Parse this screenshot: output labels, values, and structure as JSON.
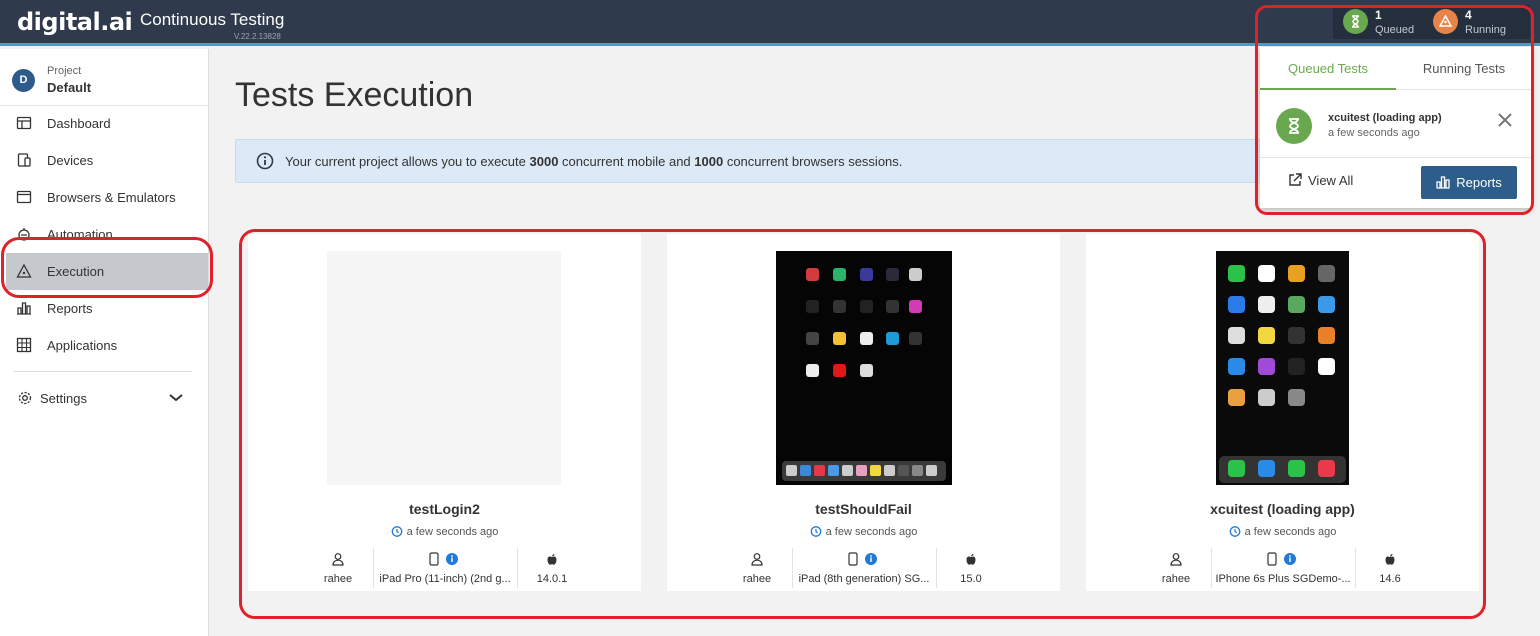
{
  "header": {
    "logo": "digital.ai",
    "app_title": "Continuous Testing",
    "version": "V.22.2.13828",
    "queued": {
      "count": "1",
      "label": "Queued",
      "icon": "hourglass-icon",
      "color": "#6aa84f"
    },
    "running": {
      "count": "4",
      "label": "Running",
      "icon": "running-icon",
      "color": "#e8834a"
    }
  },
  "sidebar": {
    "project_initial": "D",
    "project_label": "Project",
    "project_name": "Default",
    "items": [
      {
        "label": "Dashboard",
        "icon": "dashboard-icon"
      },
      {
        "label": "Devices",
        "icon": "devices-icon"
      },
      {
        "label": "Browsers & Emulators",
        "icon": "browser-icon"
      },
      {
        "label": "Automation",
        "icon": "automation-icon"
      },
      {
        "label": "Execution",
        "icon": "execution-icon",
        "active": true
      },
      {
        "label": "Reports",
        "icon": "reports-icon"
      },
      {
        "label": "Applications",
        "icon": "applications-icon"
      }
    ],
    "settings_label": "Settings"
  },
  "main": {
    "title": "Tests Execution",
    "banner": {
      "prefix": "Your current project allows you to execute ",
      "mobile_count": "3000",
      "middle": " concurrent mobile and ",
      "browser_count": "1000",
      "suffix": " concurrent browsers sessions."
    },
    "cards": [
      {
        "name": "testLogin2",
        "time": "a few seconds ago",
        "user": "rahee",
        "device": "iPad Pro (11-inch) (2nd g...",
        "os": "14.0.1"
      },
      {
        "name": "testShouldFail",
        "time": "a few seconds ago",
        "user": "rahee",
        "device": "iPad (8th generation) SG...",
        "os": "15.0"
      },
      {
        "name": "xcuitest (loading app)",
        "time": "a few seconds ago",
        "user": "rahee",
        "device": "IPhone 6s Plus SGDemo-...",
        "os": "14.6"
      }
    ]
  },
  "popup": {
    "tabs": [
      "Queued Tests",
      "Running Tests"
    ],
    "item": {
      "name": "xcuitest (loading app)",
      "time": "a few seconds ago"
    },
    "view_all": "View All",
    "reports": "Reports"
  },
  "colors": {
    "accent_green": "#6aa84f",
    "accent_orange": "#e8834a",
    "topbar": "#2f3a4c",
    "primary_button": "#2d5d8a",
    "annotation_red": "#e0202a"
  }
}
